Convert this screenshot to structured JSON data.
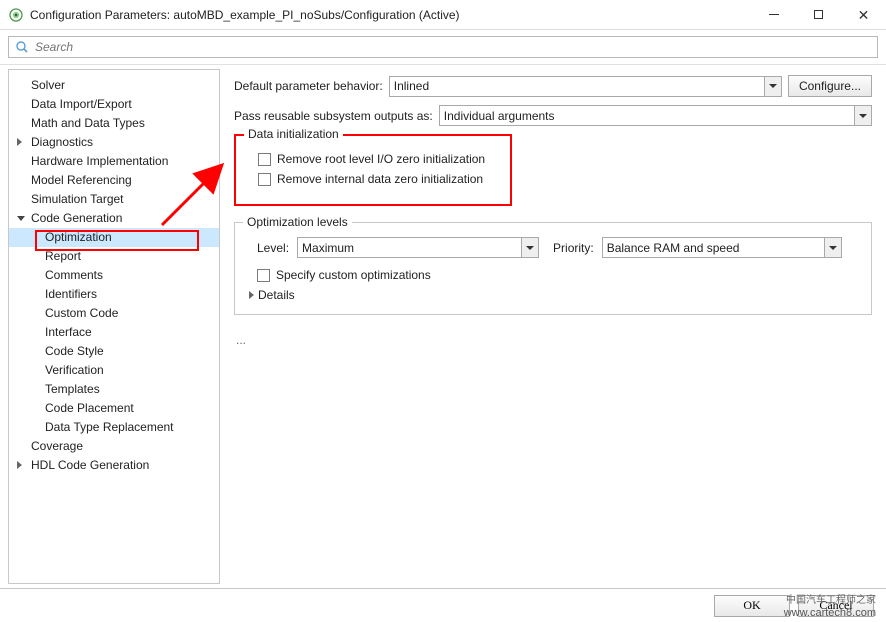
{
  "window": {
    "title": "Configuration Parameters: autoMBD_example_PI_noSubs/Configuration (Active)"
  },
  "search": {
    "placeholder": "Search"
  },
  "nav": {
    "items": [
      {
        "label": "Solver",
        "depth": 0
      },
      {
        "label": "Data Import/Export",
        "depth": 0
      },
      {
        "label": "Math and Data Types",
        "depth": 0
      },
      {
        "label": "Diagnostics",
        "depth": 0,
        "caret": "collapsed"
      },
      {
        "label": "Hardware Implementation",
        "depth": 0
      },
      {
        "label": "Model Referencing",
        "depth": 0
      },
      {
        "label": "Simulation Target",
        "depth": 0
      },
      {
        "label": "Code Generation",
        "depth": 0,
        "caret": "expanded"
      },
      {
        "label": "Optimization",
        "depth": 1,
        "selected": true
      },
      {
        "label": "Report",
        "depth": 1
      },
      {
        "label": "Comments",
        "depth": 1
      },
      {
        "label": "Identifiers",
        "depth": 1
      },
      {
        "label": "Custom Code",
        "depth": 1
      },
      {
        "label": "Interface",
        "depth": 1
      },
      {
        "label": "Code Style",
        "depth": 1
      },
      {
        "label": "Verification",
        "depth": 1
      },
      {
        "label": "Templates",
        "depth": 1
      },
      {
        "label": "Code Placement",
        "depth": 1
      },
      {
        "label": "Data Type Replacement",
        "depth": 1
      },
      {
        "label": "Coverage",
        "depth": 0
      },
      {
        "label": "HDL Code Generation",
        "depth": 0,
        "caret": "collapsed"
      }
    ]
  },
  "content": {
    "defaultParamBehavior": {
      "label": "Default parameter behavior:",
      "value": "Inlined"
    },
    "configureBtn": "Configure...",
    "passReusable": {
      "label": "Pass reusable subsystem outputs as:",
      "value": "Individual arguments"
    },
    "dataInit": {
      "title": "Data initialization",
      "opt1": "Remove root level I/O zero initialization",
      "opt2": "Remove internal data zero initialization"
    },
    "optLevels": {
      "title": "Optimization levels",
      "levelLabel": "Level:",
      "levelValue": "Maximum",
      "priorityLabel": "Priority:",
      "priorityValue": "Balance RAM and speed",
      "specifyCustom": "Specify custom optimizations",
      "details": "Details"
    },
    "ellipsis": "..."
  },
  "footer": {
    "ok": "OK",
    "cancel": "Cancel"
  },
  "watermark": {
    "line1": "中国汽车工程师之家",
    "line2": "www.cartech8.com"
  }
}
